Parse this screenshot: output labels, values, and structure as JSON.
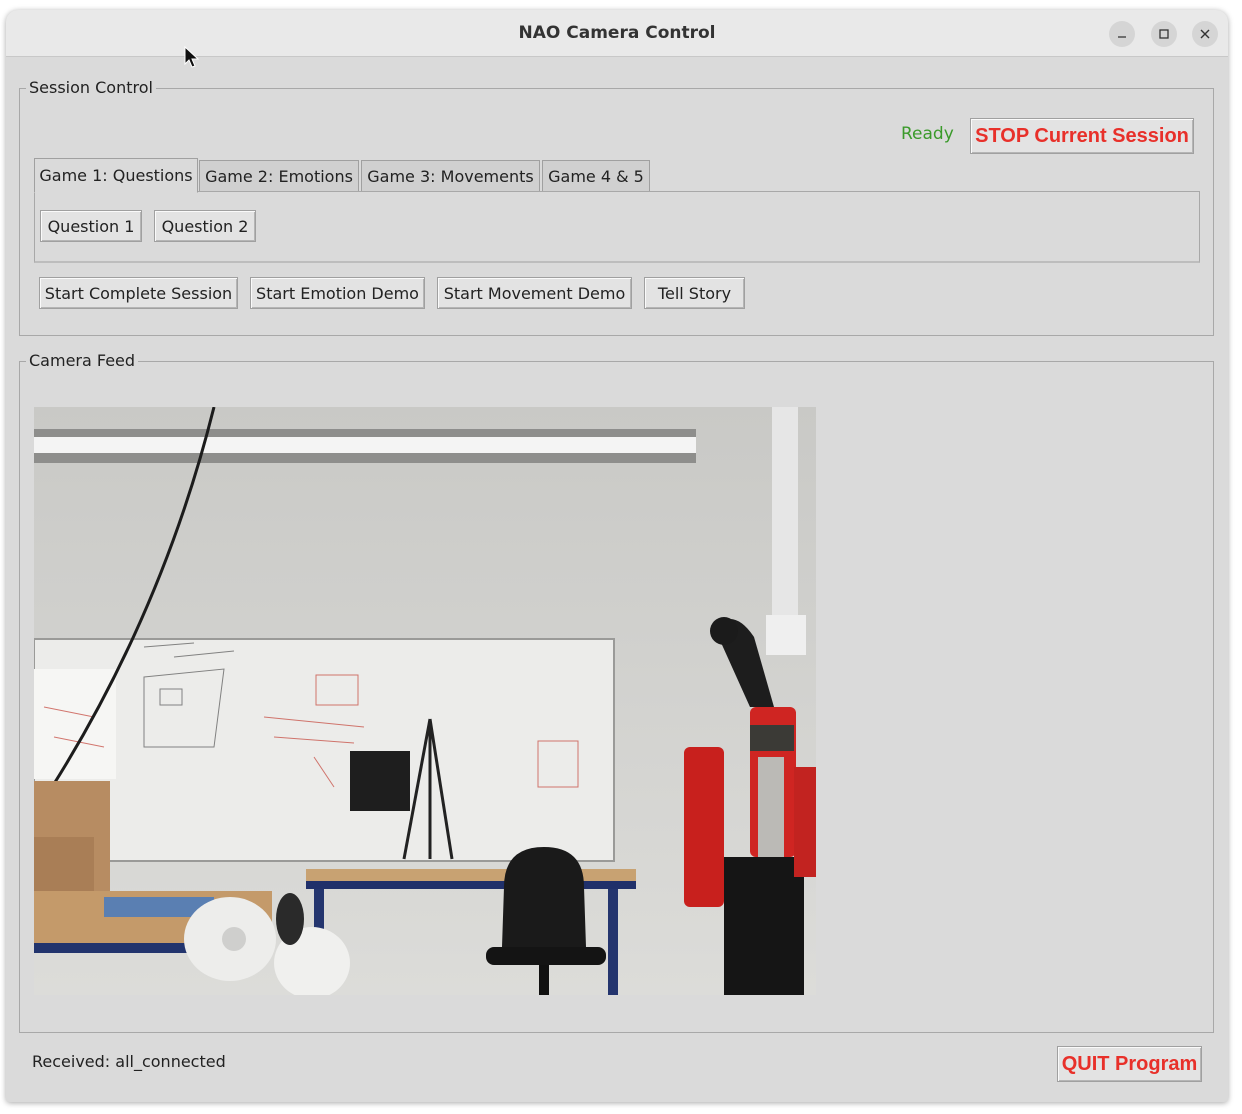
{
  "window": {
    "title": "NAO Camera Control",
    "controls": [
      "minimize-icon",
      "maximize-icon",
      "close-icon"
    ]
  },
  "session_control": {
    "label": "Session Control",
    "status_text": "Ready",
    "status_color": "#3a9a2a",
    "stop_button": "STOP Current Session",
    "tabs": [
      {
        "label": "Game 1: Questions",
        "active": true
      },
      {
        "label": "Game 2: Emotions",
        "active": false
      },
      {
        "label": "Game 3: Movements",
        "active": false
      },
      {
        "label": "Game 4 & 5",
        "active": false
      }
    ],
    "tab_buttons": [
      "Question 1",
      "Question 2"
    ],
    "actions": [
      "Start Complete Session",
      "Start Emotion Demo",
      "Start Movement Demo",
      "Tell Story"
    ]
  },
  "camera_feed": {
    "label": "Camera Feed"
  },
  "footer": {
    "received_text": "Received: all_connected",
    "quit_button": "QUIT Program"
  },
  "colors": {
    "accent_red": "#e8302a",
    "window_bg": "#dadada"
  }
}
